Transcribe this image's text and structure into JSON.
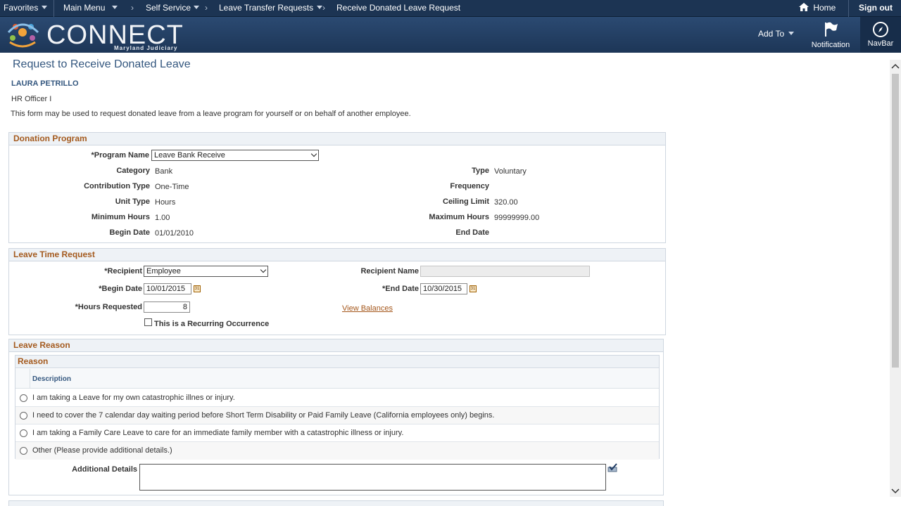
{
  "topbar": {
    "favorites": "Favorites",
    "main_menu": "Main Menu",
    "self_service": "Self Service",
    "leave_transfer": "Leave Transfer Requests",
    "current_page": "Receive Donated Leave Request",
    "home": "Home",
    "signout": "Sign out"
  },
  "banner": {
    "logo_text": "CONNECT",
    "logo_sub": "Maryland Judiciary",
    "add_to": "Add To",
    "notification": "Notification",
    "navbar": "NavBar"
  },
  "page": {
    "title": "Request to Receive Donated Leave",
    "employee_name": "LAURA PETRILLO",
    "job_title": "HR Officer I",
    "description": "This form may be used to request donated leave from a leave program for yourself or on behalf of another employee."
  },
  "donation_program": {
    "header": "Donation Program",
    "program_name_label": "*Program Name",
    "program_name_value": "Leave Bank Receive",
    "category_label": "Category",
    "category_value": "Bank",
    "type_label": "Type",
    "type_value": "Voluntary",
    "contribution_type_label": "Contribution Type",
    "contribution_type_value": "One-Time",
    "frequency_label": "Frequency",
    "unit_type_label": "Unit Type",
    "unit_type_value": "Hours",
    "ceiling_limit_label": "Ceiling Limit",
    "ceiling_limit_value": "320.00",
    "minimum_hours_label": "Minimum Hours",
    "minimum_hours_value": "1.00",
    "maximum_hours_label": "Maximum Hours",
    "maximum_hours_value": "99999999.00",
    "begin_date_label": "Begin Date",
    "begin_date_value": "01/01/2010",
    "end_date_label": "End Date"
  },
  "leave_time_request": {
    "header": "Leave Time Request",
    "recipient_label": "*Recipient",
    "recipient_value": "Employee",
    "recipient_name_label": "Recipient Name",
    "begin_date_label": "*Begin Date",
    "begin_date_value": "10/01/2015",
    "end_date_label": "*End Date",
    "end_date_value": "10/30/2015",
    "hours_requested_label": "*Hours Requested",
    "hours_requested_value": "8",
    "view_balances": "View Balances",
    "recurring_label": "This is a Recurring Occurrence"
  },
  "leave_reason": {
    "header": "Leave Reason",
    "grid_title": "Reason",
    "column_description": "Description",
    "reasons": [
      "I am taking a Leave for my own catastrophic illnes or injury.",
      "I need to cover the 7 calendar day waiting period before Short Term Disability or Paid Family Leave (California employees only) begins.",
      "I am taking a Family Care Leave to care for an immediate family member with a catastrophic illness or injury.",
      "Other (Please provide additional details.)"
    ],
    "additional_details_label": "Additional Details"
  },
  "colors": {
    "topbar": "#1c3453",
    "section_header_text": "#a45a1e",
    "title_text": "#34577f"
  }
}
